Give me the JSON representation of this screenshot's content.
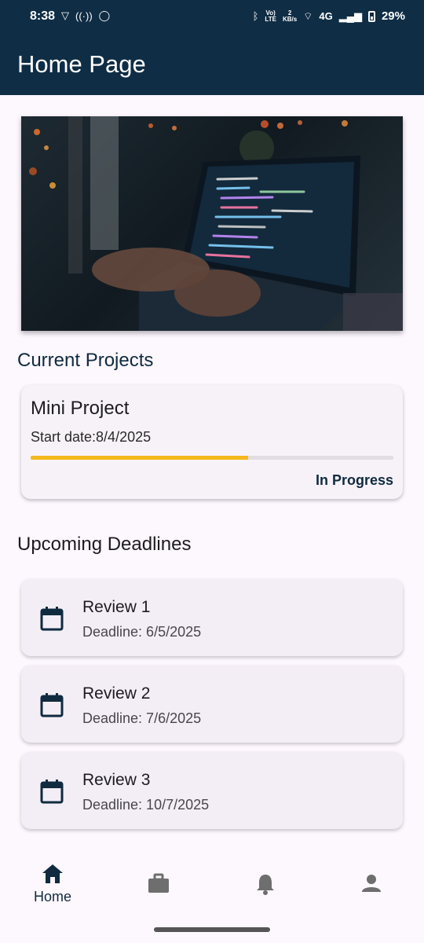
{
  "status_bar": {
    "time": "8:38",
    "data_speed_top": "2",
    "data_speed_bottom": "KB/s",
    "volte_top": "Vo)",
    "volte_bottom": "LTE",
    "network": "4G",
    "battery": "29%"
  },
  "app_bar": {
    "title": "Home Page"
  },
  "current_projects": {
    "heading": "Current Projects",
    "card": {
      "name": "Mini Project",
      "start_date": "Start date:8/4/2025",
      "progress": 0.6,
      "status": "In Progress"
    }
  },
  "upcoming_deadlines": {
    "heading": "Upcoming Deadlines",
    "items": [
      {
        "title": "Review 1",
        "deadline": "Deadline: 6/5/2025"
      },
      {
        "title": "Review 2",
        "deadline": "Deadline: 7/6/2025"
      },
      {
        "title": "Review 3",
        "deadline": "Deadline: 10/7/2025"
      }
    ]
  },
  "bottom_nav": {
    "items": [
      {
        "icon": "home-icon",
        "label": "Home",
        "active": true
      },
      {
        "icon": "briefcase-icon",
        "label": "",
        "active": false
      },
      {
        "icon": "bell-icon",
        "label": "",
        "active": false
      },
      {
        "icon": "person-icon",
        "label": "",
        "active": false
      }
    ]
  },
  "colors": {
    "app_bar": "#0f2d45",
    "progress": "#f4b81a",
    "background": "#fdf7fe"
  }
}
